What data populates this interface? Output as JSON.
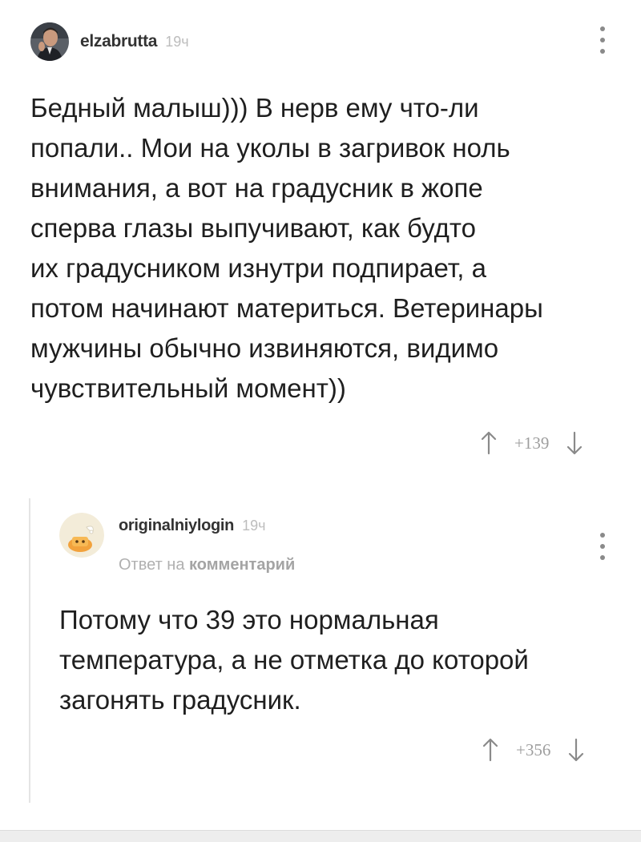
{
  "comments": [
    {
      "author": "elzabrutta",
      "time": "19ч",
      "text": "Бедный малыш))) В нерв ему что-ли\nпопали.. Мои на уколы в загривок ноль\nвнимания, а вот на градусник в жопе\nсперва глазы выпучивают, как будто\nих градусником изнутри подпирает, а\nпотом начинают материться. Ветеринары\nмужчины обычно извиняются, видимо\nчувствительный момент))",
      "score": "+139",
      "avatar_icon": "user-photo-avatar",
      "menu_icon": "more-vertical-icon"
    },
    {
      "author": "originalniylogin",
      "time": "19ч",
      "reply_prefix": "Ответ на",
      "reply_link": "комментарий",
      "text": "Потому что 39 это нормальная\nтемпература, а не отметка до которой\nзагонять градусник.",
      "score": "+356",
      "avatar_icon": "cartoon-avatar",
      "menu_icon": "more-vertical-icon"
    }
  ],
  "icons": {
    "upvote": "arrow-up-icon",
    "downvote": "arrow-down-icon"
  },
  "colors": {
    "text": "#1f1f1f",
    "muted": "#bdbdbd",
    "arrow": "#8a8a8a",
    "thread": "#e4e4e4"
  }
}
